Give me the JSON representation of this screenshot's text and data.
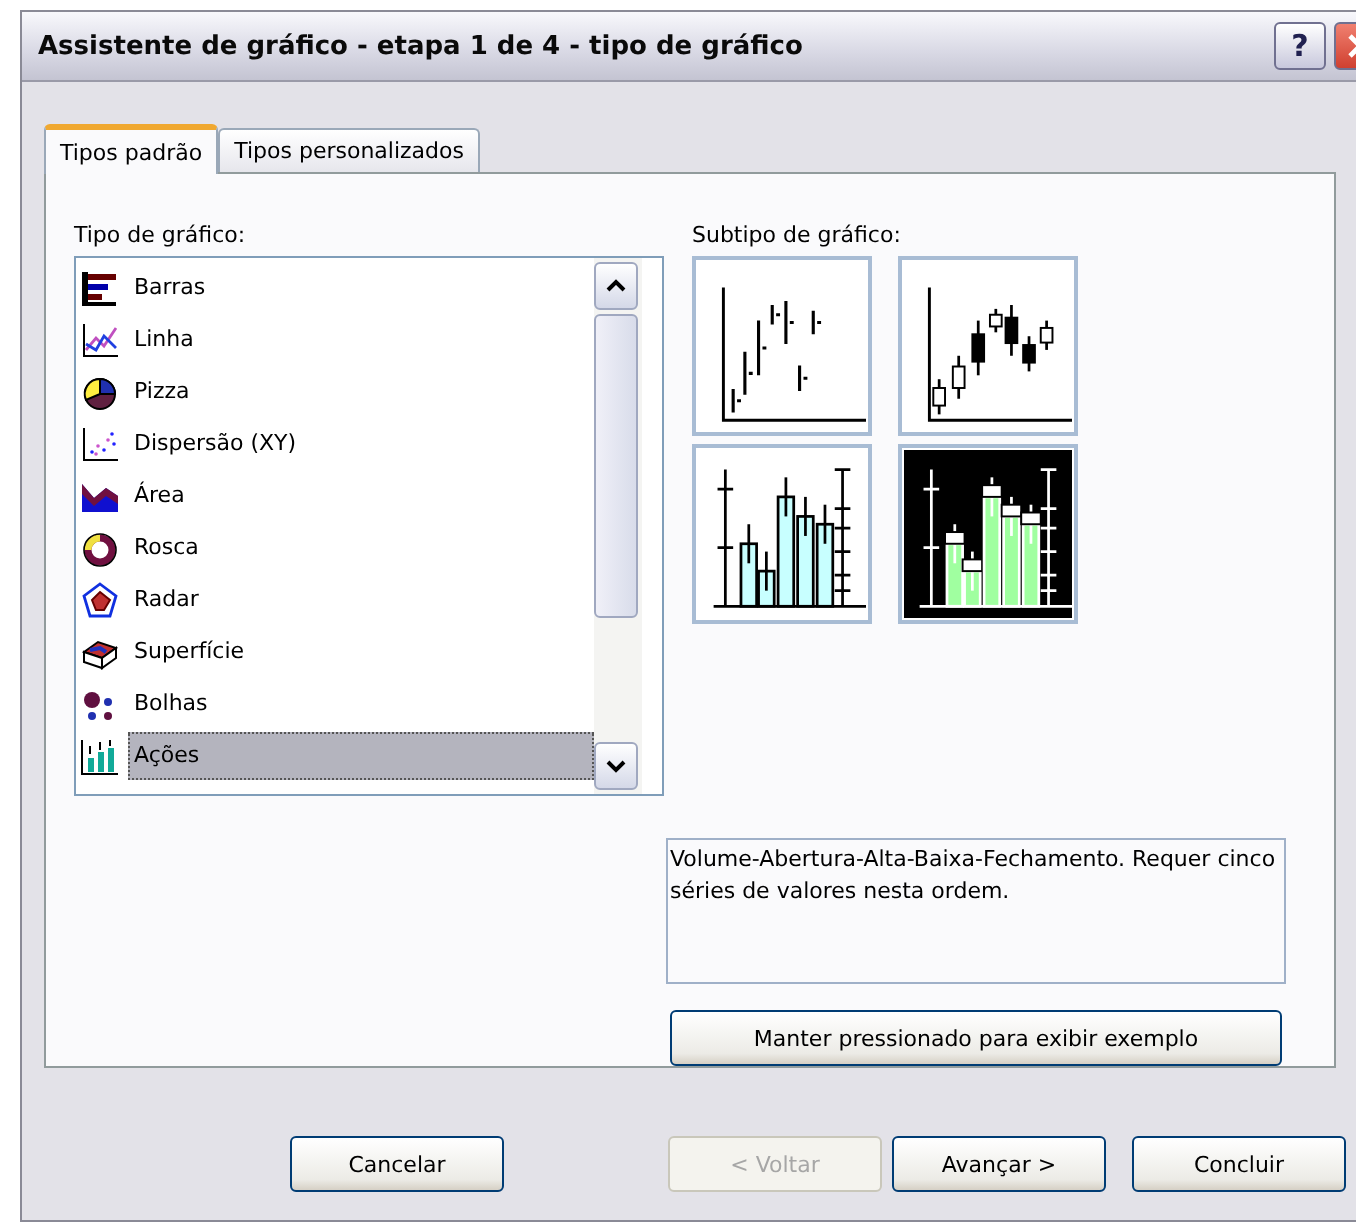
{
  "window": {
    "title": "Assistente de gráfico - etapa 1 de 4 - tipo de gráfico",
    "help": "?"
  },
  "tabs": [
    {
      "label": "Tipos padrão",
      "selected": true
    },
    {
      "label": "Tipos personalizados",
      "selected": false
    }
  ],
  "chart_types": {
    "label": "Tipo de gráfico:",
    "items": [
      {
        "kind": "bar",
        "label": "Barras",
        "selected": false
      },
      {
        "kind": "line",
        "label": "Linha",
        "selected": false
      },
      {
        "kind": "pie",
        "label": "Pizza",
        "selected": false
      },
      {
        "kind": "scatter",
        "label": "Dispersão (XY)",
        "selected": false
      },
      {
        "kind": "area",
        "label": "Área",
        "selected": false
      },
      {
        "kind": "doughnut",
        "label": "Rosca",
        "selected": false
      },
      {
        "kind": "radar",
        "label": "Radar",
        "selected": false
      },
      {
        "kind": "surface",
        "label": "Superfície",
        "selected": false
      },
      {
        "kind": "bubble",
        "label": "Bolhas",
        "selected": false
      },
      {
        "kind": "stock",
        "label": "Ações",
        "selected": true
      }
    ]
  },
  "subtypes": {
    "label": "Subtipo de gráfico:",
    "items": [
      {
        "kind": "high-low-close",
        "selected": false
      },
      {
        "kind": "open-high-low-close",
        "selected": false
      },
      {
        "kind": "volume-high-low-close",
        "selected": false
      },
      {
        "kind": "volume-open-high-low-close",
        "selected": true
      }
    ]
  },
  "description": "Volume-Abertura-Alta-Baixa-Fechamento. Requer cinco séries de valores nesta ordem.",
  "preview_button": "Manter pressionado para exibir exemplo",
  "buttons": [
    {
      "label": "Cancelar",
      "disabled": false
    },
    {
      "label": "< Voltar",
      "disabled": true
    },
    {
      "label": "Avançar >",
      "disabled": false
    },
    {
      "label": "Concluir",
      "disabled": false
    }
  ]
}
